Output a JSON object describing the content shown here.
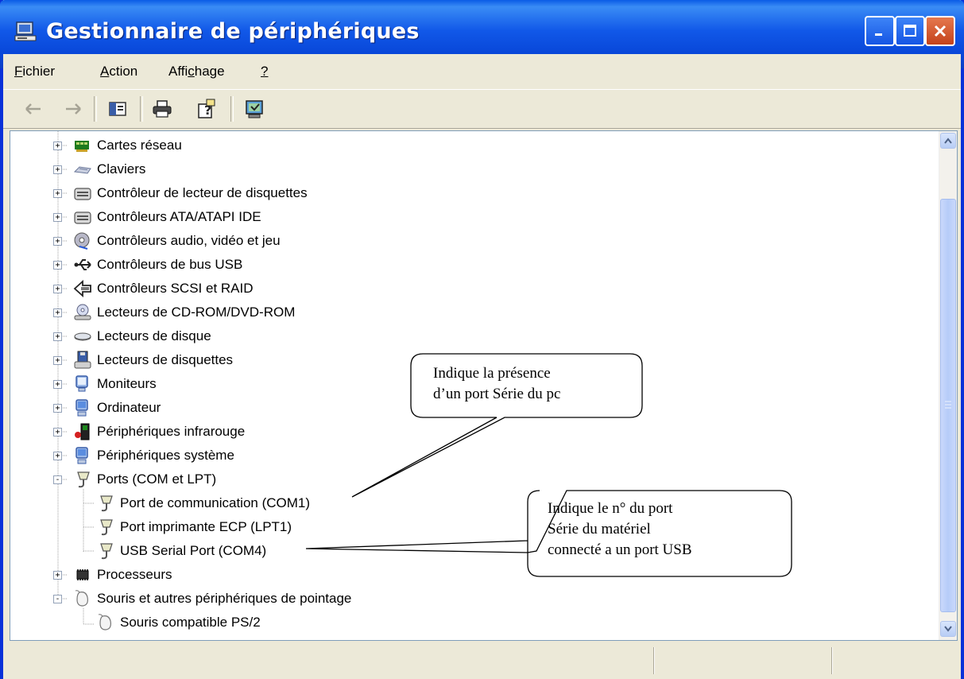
{
  "window": {
    "title": "Gestionnaire de périphériques",
    "buttons": [
      "minimize",
      "maximize",
      "close"
    ]
  },
  "menu": [
    {
      "label": "Fichier",
      "accel": "F",
      "rest": "ichier"
    },
    {
      "label": "Action",
      "accel": "A",
      "rest": "ction"
    },
    {
      "label": "Affichage",
      "pre": "Affi",
      "accel": "c",
      "rest": "hage"
    },
    {
      "label": "?",
      "accel": "?",
      "rest": ""
    }
  ],
  "toolbar": {
    "icons": [
      "back-arrow-icon",
      "forward-arrow-icon",
      "show-hide-console-tree-icon",
      "print-icon",
      "properties-help-icon",
      "scan-hardware-icon"
    ]
  },
  "tree": {
    "items": [
      {
        "label": "Cartes réseau",
        "icon": "network-card-icon",
        "expand": "+"
      },
      {
        "label": "Claviers",
        "icon": "keyboard-icon",
        "expand": "+"
      },
      {
        "label": "Contrôleur de lecteur de disquettes",
        "icon": "floppy-controller-icon",
        "expand": "+"
      },
      {
        "label": "Contrôleurs ATA/ATAPI IDE",
        "icon": "ide-controller-icon",
        "expand": "+"
      },
      {
        "label": "Contrôleurs audio, vidéo et jeu",
        "icon": "audio-icon",
        "expand": "+"
      },
      {
        "label": "Contrôleurs de bus USB",
        "icon": "usb-icon",
        "expand": "+"
      },
      {
        "label": "Contrôleurs SCSI et RAID",
        "icon": "scsi-icon",
        "expand": "+"
      },
      {
        "label": "Lecteurs de CD-ROM/DVD-ROM",
        "icon": "cdrom-icon",
        "expand": "+"
      },
      {
        "label": "Lecteurs de disque",
        "icon": "disk-icon",
        "expand": "+"
      },
      {
        "label": "Lecteurs de disquettes",
        "icon": "floppy-drive-icon",
        "expand": "+"
      },
      {
        "label": "Moniteurs",
        "icon": "monitor-icon",
        "expand": "+"
      },
      {
        "label": "Ordinateur",
        "icon": "computer-icon",
        "expand": "+"
      },
      {
        "label": "Périphériques infrarouge",
        "icon": "infrared-icon",
        "expand": "+"
      },
      {
        "label": "Périphériques système",
        "icon": "system-icon",
        "expand": "+"
      },
      {
        "label": "Ports (COM et LPT)",
        "icon": "port-icon",
        "expand": "-"
      },
      {
        "label": "Port de communication (COM1)",
        "icon": "port-icon",
        "expand": ""
      },
      {
        "label": "Port imprimante ECP (LPT1)",
        "icon": "port-icon",
        "expand": ""
      },
      {
        "label": "USB Serial Port (COM4)",
        "icon": "port-icon",
        "expand": ""
      },
      {
        "label": "Processeurs",
        "icon": "processor-icon",
        "expand": "+"
      },
      {
        "label": "Souris et autres périphériques de pointage",
        "icon": "mouse-icon",
        "expand": "-"
      },
      {
        "label": "Souris compatible PS/2",
        "icon": "mouse-icon",
        "expand": ""
      }
    ]
  },
  "callouts": [
    {
      "lines": [
        "Indique la présence",
        "d’un port Série du pc"
      ]
    },
    {
      "lines": [
        "Indique le n° du port",
        "Série du matériel",
        "connecté a un port USB"
      ]
    }
  ],
  "colors": {
    "titlebar": "#0a5be6",
    "close": "#c4421b",
    "chrome": "#ece9d8",
    "tree_line": "#a0a0a0"
  }
}
